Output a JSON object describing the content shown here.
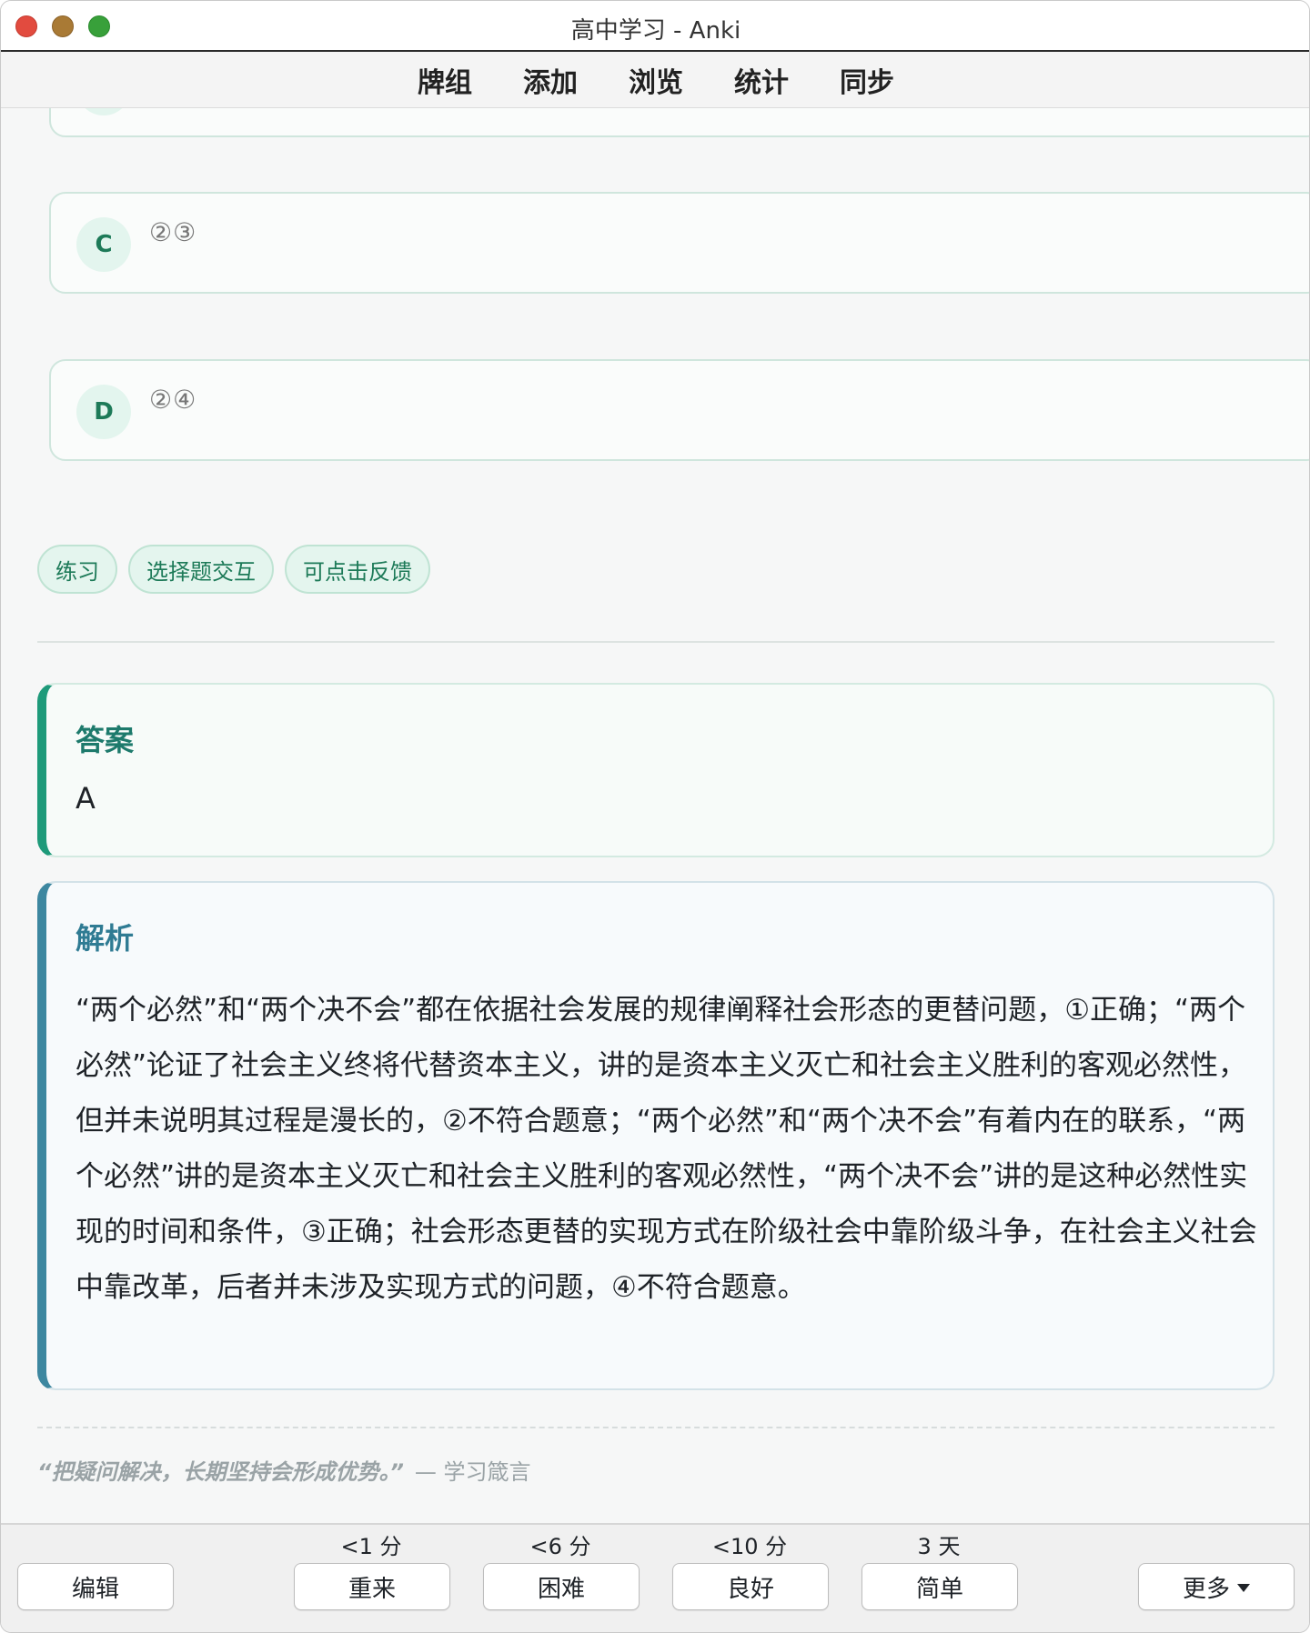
{
  "window": {
    "title": "高中学习 - Anki"
  },
  "toolbar": {
    "items": [
      "牌组",
      "添加",
      "浏览",
      "统计",
      "同步"
    ]
  },
  "options": [
    {
      "letter": "C",
      "text": "②③"
    },
    {
      "letter": "D",
      "text": "②④"
    }
  ],
  "tags": [
    "练习",
    "选择题交互",
    "可点击反馈"
  ],
  "answer": {
    "title": "答案",
    "value": "A"
  },
  "analysis": {
    "title": "解析",
    "text": "“两个必然”和“两个决不会”都在依据社会发展的规律阐释社会形态的更替问题，①正确；“两个必然”论证了社会主义终将代替资本主义，讲的是资本主义灭亡和社会主义胜利的客观必然性，但并未说明其过程是漫长的，②不符合题意；“两个必然”和“两个决不会”有着内在的联系，“两个必然”讲的是资本主义灭亡和社会主义胜利的客观必然性，“两个决不会”讲的是这种必然性实现的时间和条件，③正确；社会形态更替的实现方式在阶级社会中靠阶级斗争，在社会主义社会中靠改革，后者并未涉及实现方式的问题，④不符合题意。"
  },
  "quote": {
    "text": "“把疑问解决，长期坚持会形成优势。”",
    "source": "— 学习箴言"
  },
  "bottom": {
    "edit_label": "编辑",
    "more_label": "更多",
    "answers": [
      {
        "interval": "<1 分",
        "label": "重来"
      },
      {
        "interval": "<6 分",
        "label": "困难"
      },
      {
        "interval": "<10 分",
        "label": "良好"
      },
      {
        "interval": "3 天",
        "label": "简单"
      }
    ]
  },
  "colors": {
    "accent_green": "#1e9a7a",
    "accent_blue": "#3d87a0",
    "tag_bg": "#e4f5ee"
  }
}
